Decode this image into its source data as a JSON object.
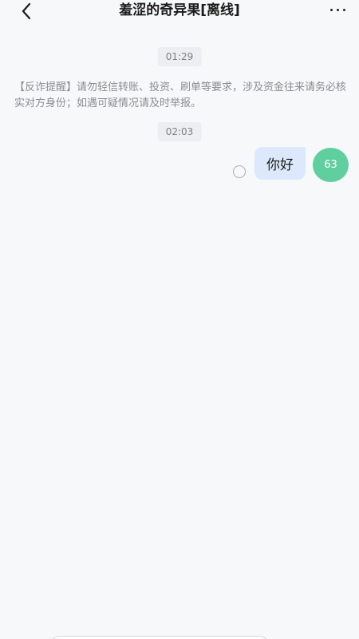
{
  "header": {
    "title": "羞涩的奇异果[离线]"
  },
  "messages": {
    "time1": "01:29",
    "notice": "【反诈提醒】请勿轻信转账、投资、刷单等要求，涉及资金往来请务必核实对方身份；如遇可疑情况请及时举报。",
    "time2": "02:03",
    "outgoing_text": "你好",
    "avatar_label": "63"
  },
  "icons": {
    "back": "chevron-left-icon",
    "more": "more-horizontal-icon",
    "status": "pending-circle-icon"
  },
  "colors": {
    "background": "#f7f8fa",
    "bubble": "#dce9fc",
    "avatar": "#5fcfa0"
  }
}
